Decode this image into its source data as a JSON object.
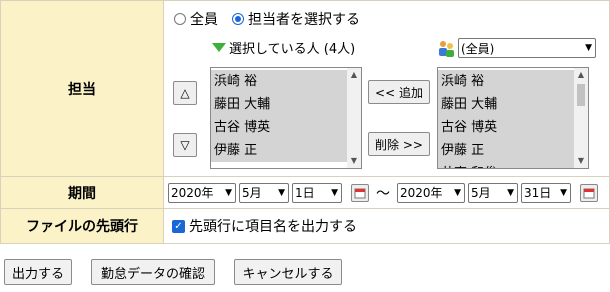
{
  "rows": {
    "assignee_label": "担当",
    "period_label": "期間",
    "file_header_label": "ファイルの先頭行"
  },
  "assignee": {
    "radio_all": "全員",
    "radio_select": "担当者を選択する",
    "selected_heading": "選択している人 (4人)",
    "selected_list": [
      "浜崎 裕",
      "藤田 大輔",
      "古谷 博英",
      "伊藤 正"
    ],
    "group_select_value": "(全員)",
    "source_list": [
      "浜崎 裕",
      "藤田 大輔",
      "古谷 博英",
      "伊藤 正",
      "井東 和俊"
    ],
    "add_label": "<< 追加",
    "remove_label": "削除 >>",
    "up_arrow": "△",
    "down_arrow": "▽"
  },
  "period": {
    "from_year": "2020年",
    "from_month": "5月",
    "from_day": "1日",
    "separator": "～",
    "to_year": "2020年",
    "to_month": "5月",
    "to_day": "31日"
  },
  "file_header": {
    "checkbox_label": "先頭行に項目名を出力する",
    "checked": true
  },
  "actions": {
    "output_label": "出力する",
    "check_attendance_label": "勤怠データの確認",
    "cancel_label": "キャンセルする"
  }
}
